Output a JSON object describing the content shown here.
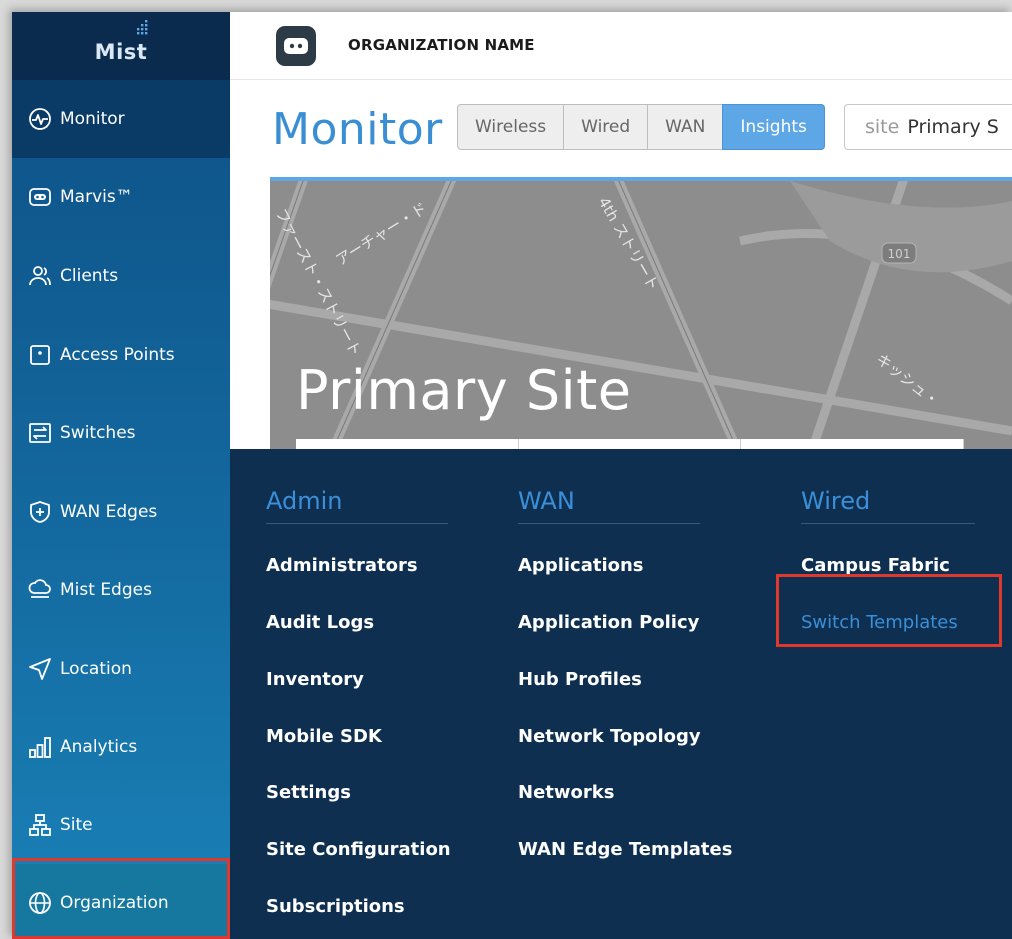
{
  "logo": {
    "text": "Mist"
  },
  "topbar": {
    "org_name": "ORGANIZATION NAME"
  },
  "sidebar": {
    "items": [
      {
        "label": "Monitor",
        "icon": "monitor-pulse-icon"
      },
      {
        "label": "Marvis™",
        "icon": "marvis-icon"
      },
      {
        "label": "Clients",
        "icon": "clients-icon"
      },
      {
        "label": "Access Points",
        "icon": "access-point-icon"
      },
      {
        "label": "Switches",
        "icon": "switch-icon"
      },
      {
        "label": "WAN Edges",
        "icon": "wan-edge-icon"
      },
      {
        "label": "Mist Edges",
        "icon": "mist-edge-icon"
      },
      {
        "label": "Location",
        "icon": "location-icon"
      },
      {
        "label": "Analytics",
        "icon": "analytics-icon"
      },
      {
        "label": "Site",
        "icon": "site-icon"
      },
      {
        "label": "Organization",
        "icon": "globe-icon"
      }
    ]
  },
  "monitor": {
    "title": "Monitor",
    "tabs": [
      "Wireless",
      "Wired",
      "WAN",
      "Insights"
    ],
    "active_tab": "Insights",
    "site_label": "site",
    "site_value": "Primary S"
  },
  "map": {
    "site_name": "Primary Site",
    "street_labels": [
      "ファースト・ストリート",
      "アーチャー・ド",
      "4th ストリート",
      "キッシュ・",
      "101"
    ]
  },
  "menu": {
    "admin": {
      "heading": "Admin",
      "items": [
        "Administrators",
        "Audit Logs",
        "Inventory",
        "Mobile SDK",
        "Settings",
        "Site Configuration",
        "Subscriptions"
      ]
    },
    "wan": {
      "heading": "WAN",
      "items": [
        "Applications",
        "Application Policy",
        "Hub Profiles",
        "Network Topology",
        "Networks",
        "WAN Edge Templates"
      ]
    },
    "wired": {
      "heading": "Wired",
      "items": [
        "Campus Fabric",
        "Switch Templates"
      ]
    }
  },
  "colors": {
    "accent_blue": "#3b8ed8",
    "menu_bg": "#0e2f4f",
    "highlight_red": "#e0382c",
    "active_tab": "#5ea7e6"
  }
}
